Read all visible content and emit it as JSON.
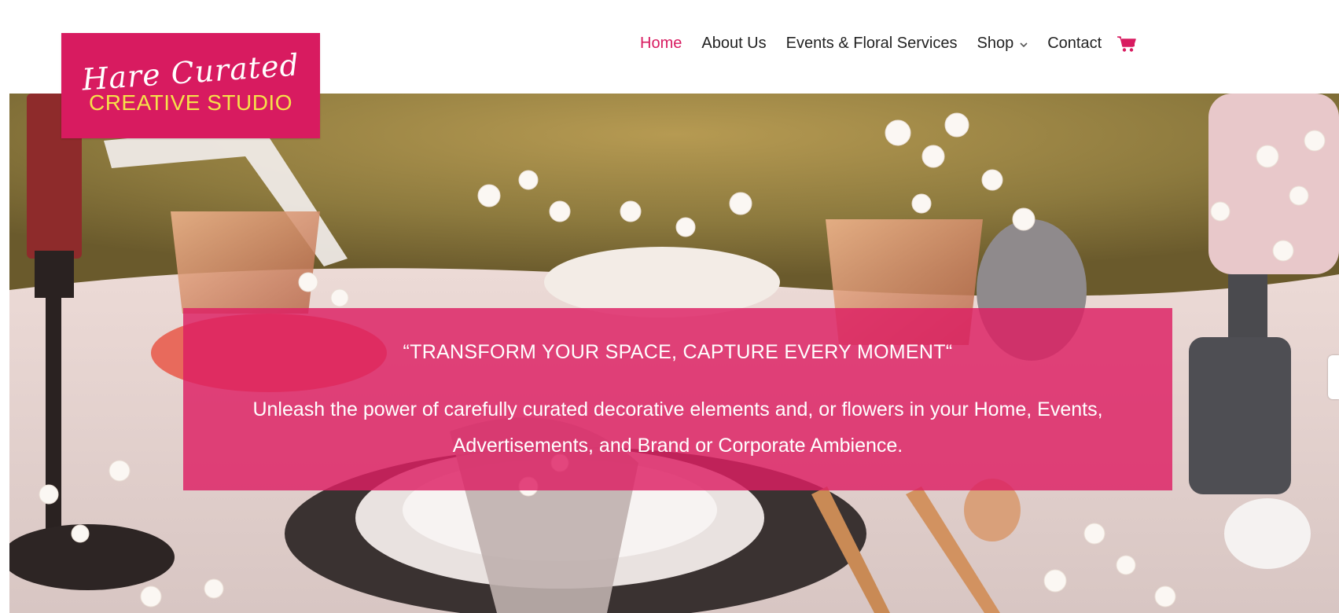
{
  "logo": {
    "script_text": "Hare Curated",
    "sub_text": "CREATIVE STUDIO",
    "background_color": "#d81b60",
    "sub_text_color": "#f5e14a"
  },
  "nav": {
    "items": [
      {
        "label": "Home",
        "active": true
      },
      {
        "label": "About Us",
        "active": false
      },
      {
        "label": "Events & Floral Services",
        "active": false
      },
      {
        "label": "Shop",
        "active": false,
        "has_dropdown": true
      },
      {
        "label": "Contact",
        "active": false
      }
    ],
    "cart_icon": "shopping-cart-icon",
    "dropdown_icon": "chevron-down-icon",
    "accent_color": "#d81b60"
  },
  "hero": {
    "banner_title": "“TRANSFORM YOUR SPACE, CAPTURE EVERY MOMENT“",
    "banner_text": "Unleash the power of carefully curated decorative elements and, or flowers in your Home, Events, Advertisements, and Brand or Corporate Ambience.",
    "banner_color": "#dd1f63"
  }
}
